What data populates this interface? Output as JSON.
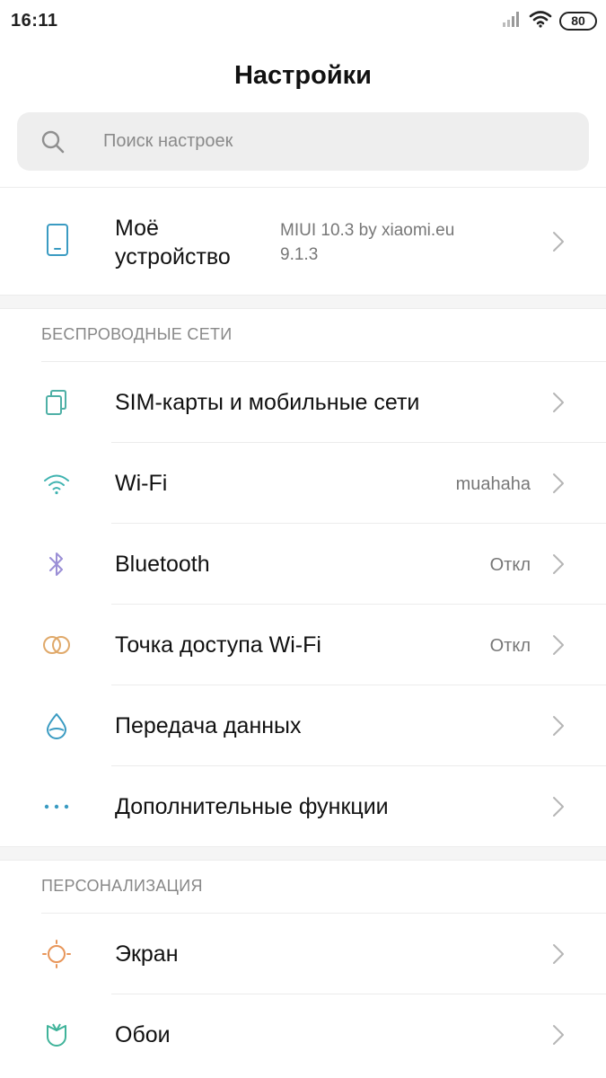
{
  "status_bar": {
    "time": "16:11",
    "battery": "80",
    "icons": [
      "signal-icon",
      "wifi-icon",
      "battery-icon"
    ]
  },
  "title": "Настройки",
  "search": {
    "placeholder": "Поиск настроек",
    "icon": "search-icon"
  },
  "device": {
    "label_line1": "Моё",
    "label_line2": "устройство",
    "value_line1": "MIUI 10.3 by xiaomi.eu",
    "value_line2": "9.1.3",
    "icon": "phone-icon"
  },
  "sections": [
    {
      "header": "БЕСПРОВОДНЫЕ СЕТИ",
      "items": [
        {
          "label": "SIM-карты и мобильные сети",
          "value": "",
          "icon": "sim-icon"
        },
        {
          "label": "Wi-Fi",
          "value": "muahaha",
          "icon": "wifi-icon"
        },
        {
          "label": "Bluetooth",
          "value": "Откл",
          "icon": "bluetooth-icon"
        },
        {
          "label": "Точка доступа Wi-Fi",
          "value": "Откл",
          "icon": "hotspot-icon"
        },
        {
          "label": "Передача данных",
          "value": "",
          "icon": "data-usage-icon"
        },
        {
          "label": "Дополнительные функции",
          "value": "",
          "icon": "more-icon"
        }
      ]
    },
    {
      "header": "ПЕРСОНАЛИЗАЦИЯ",
      "items": [
        {
          "label": "Экран",
          "value": "",
          "icon": "display-icon"
        },
        {
          "label": "Обои",
          "value": "",
          "icon": "wallpaper-icon"
        }
      ]
    }
  ],
  "colors": {
    "sim": "#4fb0a6",
    "wifi": "#3fb3b0",
    "bluetooth": "#9b8fd6",
    "hotspot": "#e0a96a",
    "data": "#3a9bc2",
    "more": "#3a9bc2",
    "display": "#e8965a",
    "wallpaper": "#3fb39a",
    "device": "#3a9bc2"
  }
}
